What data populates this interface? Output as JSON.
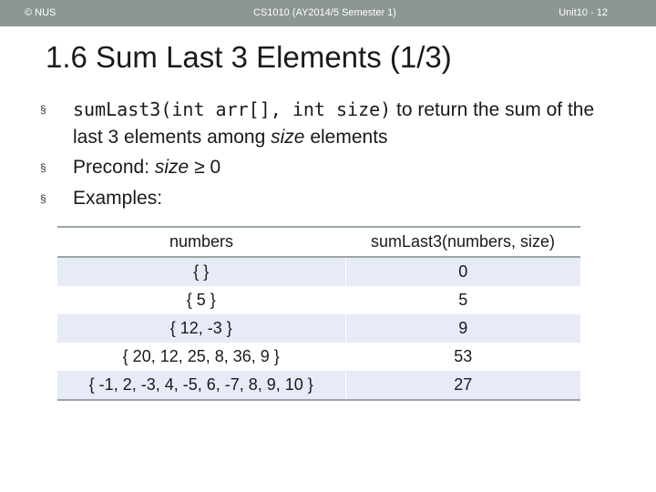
{
  "header": {
    "left": "© NUS",
    "center": "CS1010 (AY2014/5 Semester 1)",
    "right": "Unit10 - 12"
  },
  "slide": {
    "title": "1.6 Sum Last 3 Elements (1/3)",
    "bullet_marker": "§",
    "bullet1": {
      "code": "sumLast3(int arr[], int size)",
      "text1": " to return the sum of the last 3 elements among ",
      "italic": "size",
      "text2": " elements"
    },
    "bullet2": {
      "text1": "Precond: ",
      "italic": "size",
      "text2": " ≥ 0"
    },
    "bullet3": {
      "text": "Examples:"
    }
  },
  "table": {
    "headers": [
      "numbers",
      "sumLast3(numbers, size)"
    ],
    "rows": [
      {
        "numbers": "{ }",
        "result": "0"
      },
      {
        "numbers": "{ 5 }",
        "result": "5"
      },
      {
        "numbers": "{ 12, -3 }",
        "result": "9"
      },
      {
        "numbers": "{ 20, 12, 25, 8, 36, 9 }",
        "result": "53"
      },
      {
        "numbers": "{ -1, 2, -3, 4, -5, 6, -7, 8, 9, 10 }",
        "result": "27"
      }
    ]
  },
  "colors": {
    "header_bar": "#8c9694",
    "row_shade": "#e7eaf7",
    "table_rule": "#9aa6a5"
  }
}
